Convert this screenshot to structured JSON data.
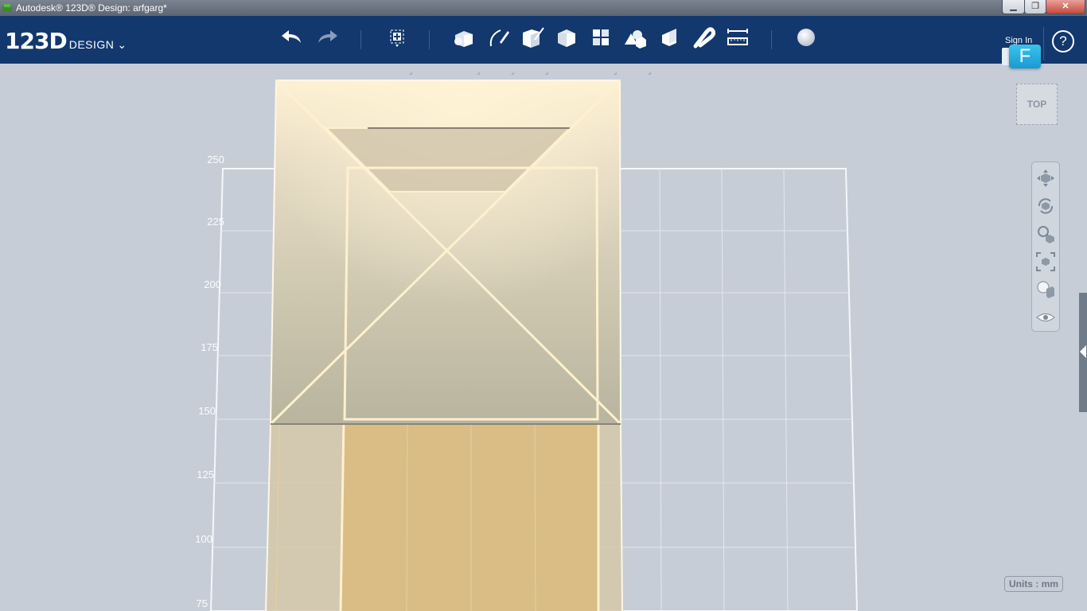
{
  "window": {
    "title": "Autodesk® 123D® Design: arfgarg*",
    "minimize_glyph": "▁",
    "maximize_glyph": "❐",
    "close_glyph": "✕"
  },
  "brand": {
    "logo": "123D",
    "product": "DESIGN",
    "menu_chevron": "⌄"
  },
  "toolbar": {
    "tools": [
      {
        "name": "undo-icon"
      },
      {
        "name": "redo-icon"
      },
      {
        "name": "transform-icon"
      },
      {
        "name": "primitives-icon"
      },
      {
        "name": "sketch-icon"
      },
      {
        "name": "construct-icon"
      },
      {
        "name": "modify-icon"
      },
      {
        "name": "pattern-icon"
      },
      {
        "name": "grouping-icon"
      },
      {
        "name": "combine-icon"
      },
      {
        "name": "snap-icon"
      },
      {
        "name": "measure-icon"
      },
      {
        "name": "material-icon"
      }
    ],
    "sign_in_label": "Sign In",
    "user_initial": "F",
    "help_label": "?"
  },
  "viewport": {
    "grid_y_labels": [
      "250",
      "225",
      "200",
      "175",
      "150",
      "125",
      "100",
      "75"
    ],
    "view_cube_label": "TOP",
    "navigation": [
      {
        "name": "pan-icon"
      },
      {
        "name": "orbit-icon"
      },
      {
        "name": "zoom-icon"
      },
      {
        "name": "fit-icon"
      },
      {
        "name": "visual-style-icon"
      },
      {
        "name": "visibility-icon"
      }
    ],
    "units_label": "Units : mm"
  },
  "colors": {
    "toolbar": "#12386e",
    "viewport": "#c6cdd6",
    "grid": "#ffffff",
    "solid": "#d7c9a8",
    "solid_highlight": "#fdf1d8",
    "base": "#d9bd85",
    "edge": "#fff0cf",
    "badge": "#1a9ad3"
  }
}
